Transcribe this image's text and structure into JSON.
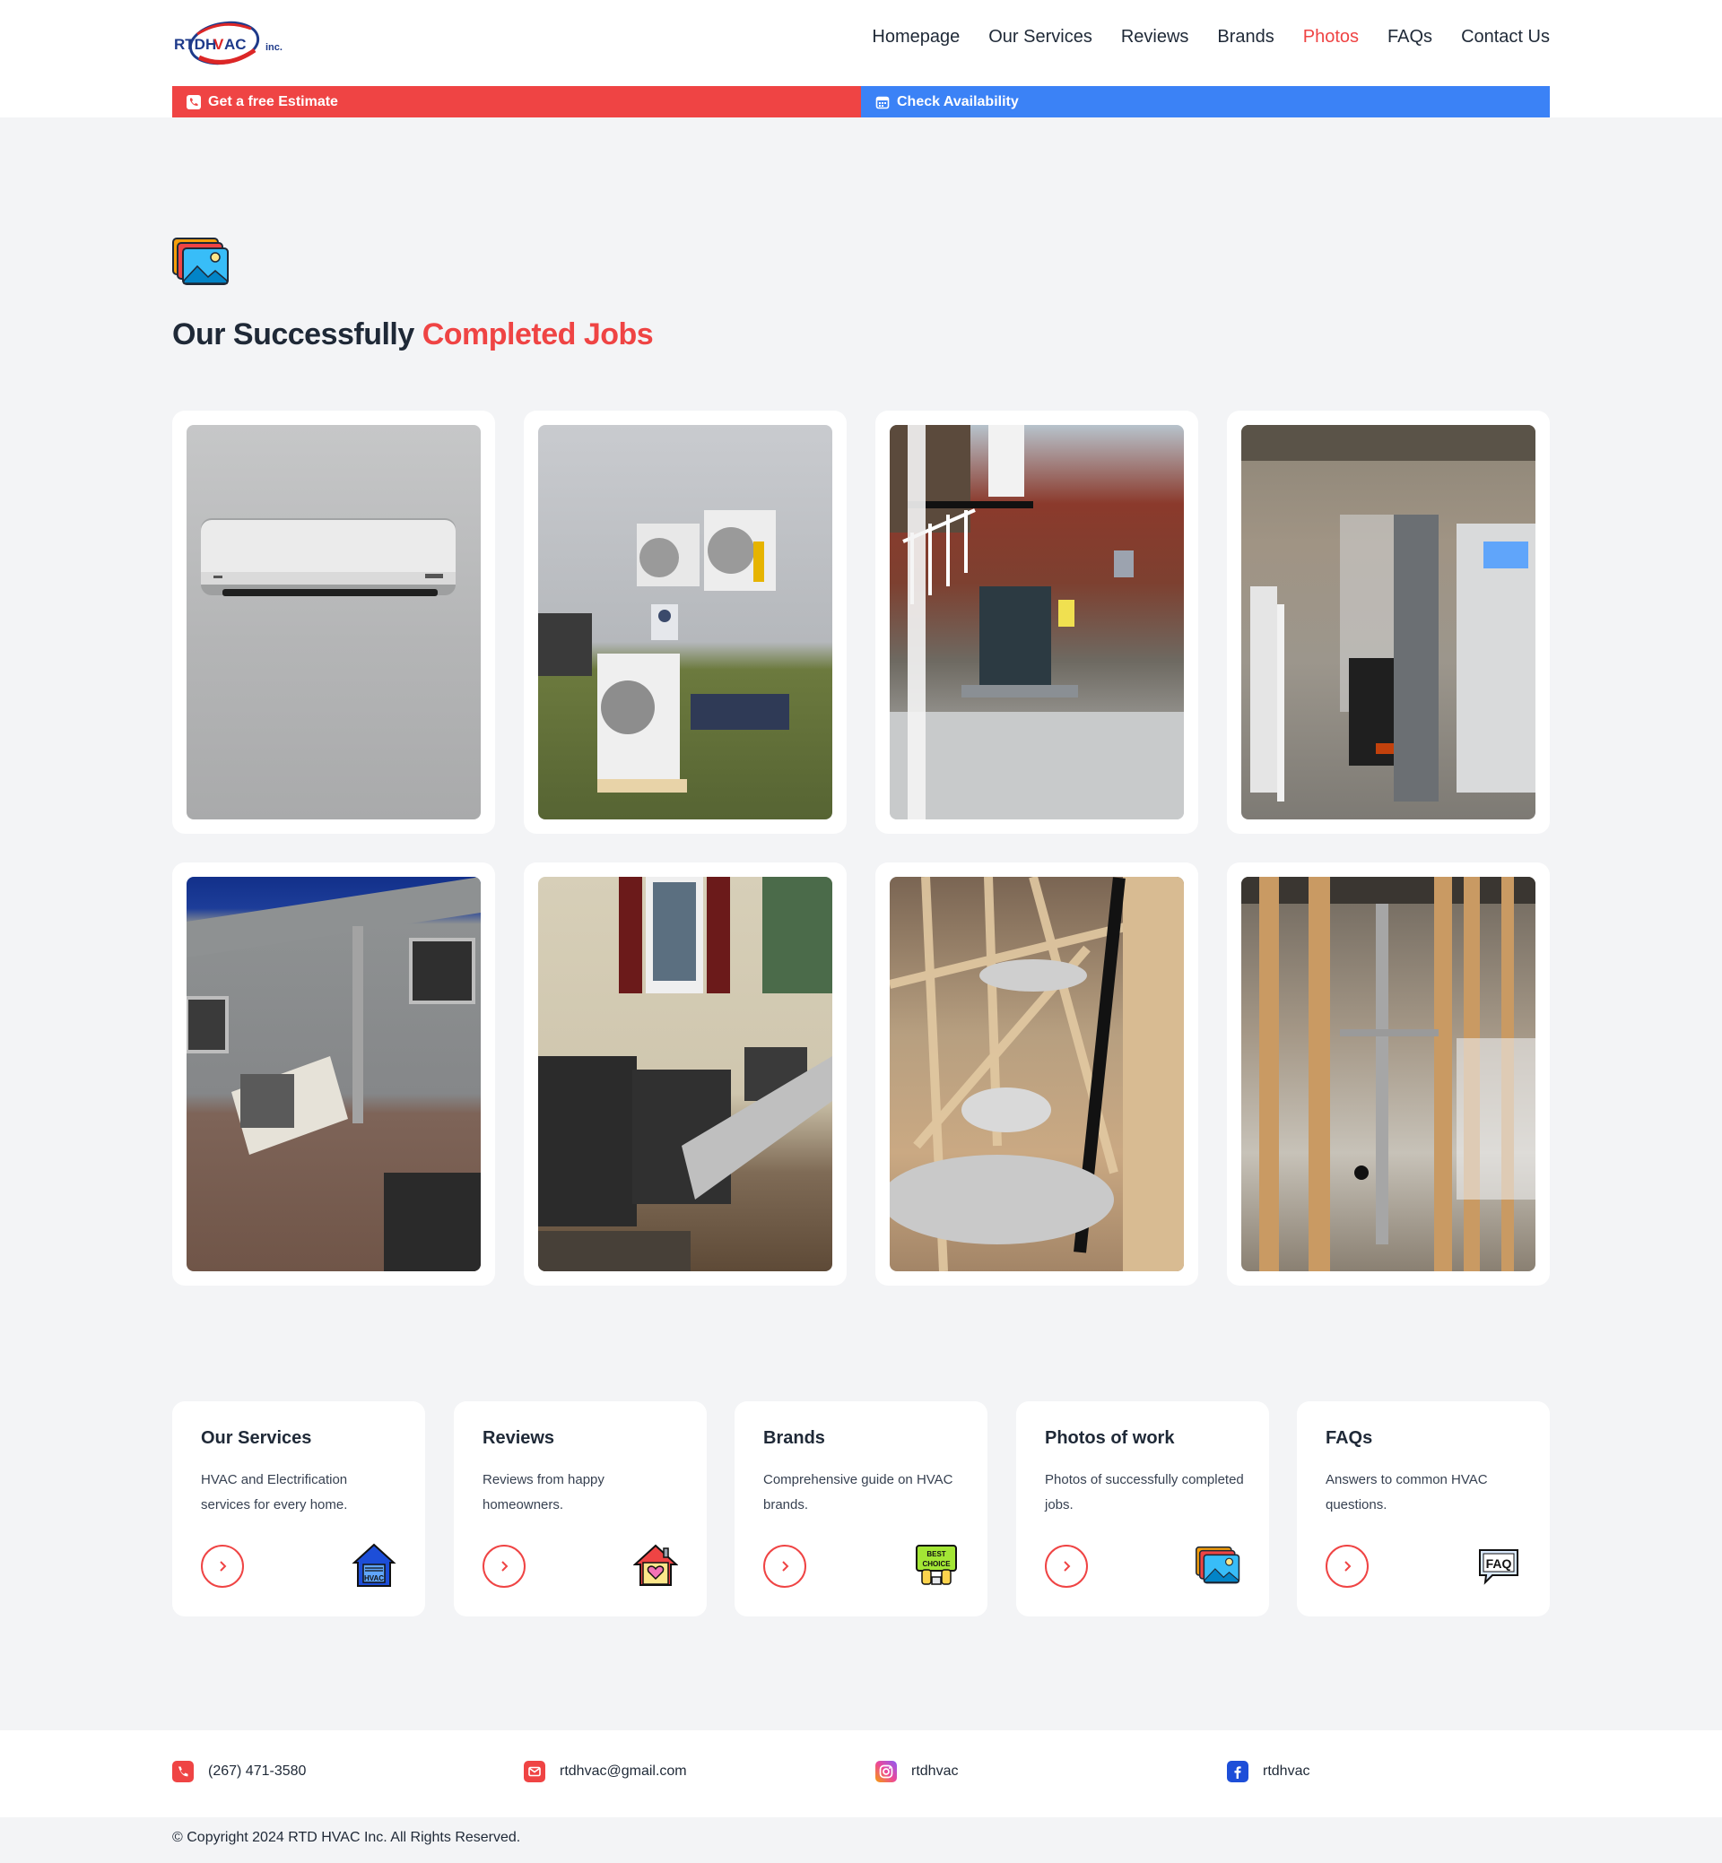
{
  "brand": {
    "logo_text": "RTDHVAC",
    "logo_suffix": "inc."
  },
  "nav": {
    "items": [
      {
        "label": "Homepage"
      },
      {
        "label": "Our Services"
      },
      {
        "label": "Reviews"
      },
      {
        "label": "Brands"
      },
      {
        "label": "Photos",
        "active": true
      },
      {
        "label": "FAQs"
      },
      {
        "label": "Contact Us"
      }
    ]
  },
  "cta": {
    "estimate_label": "Get a free Estimate",
    "availability_label": "Check Availability"
  },
  "hero": {
    "title_main": "Our Successfully ",
    "title_accent": "Completed Jobs"
  },
  "photos": [
    {
      "subject": "wall-mounted mini split indoor unit"
    },
    {
      "subject": "technician installing outdoor condensers"
    },
    {
      "subject": "AC condenser beside brick stairs"
    },
    {
      "subject": "furnace in basement"
    },
    {
      "subject": "wall-mounted heat pump outdoor unit"
    },
    {
      "subject": "condensers on pad beside house"
    },
    {
      "subject": "ductwork in attic trusses"
    },
    {
      "subject": "ducts in wood framing"
    }
  ],
  "services": [
    {
      "title": "Our Services",
      "desc": "HVAC and Electrification services for every home.",
      "icon": "hvac-house-icon"
    },
    {
      "title": "Reviews",
      "desc": "Reviews from happy homeowners.",
      "icon": "home-heart-icon"
    },
    {
      "title": "Brands",
      "desc": "Comprehensive guide on HVAC brands.",
      "icon": "best-choice-icon",
      "icon_text": "BEST CHOICE"
    },
    {
      "title": "Photos of work",
      "desc": "Photos of successfully completed jobs.",
      "icon": "photos-icon"
    },
    {
      "title": "FAQs",
      "desc": "Answers to common HVAC questions.",
      "icon": "faq-icon",
      "icon_text": "FAQ"
    }
  ],
  "footer": {
    "phone": "(267) 471-3580",
    "email": "rtdhvac@gmail.com",
    "instagram": "rtdhvac",
    "facebook": "rtdhvac",
    "copyright": "© Copyright 2024 RTD HVAC Inc. All Rights Reserved."
  },
  "colors": {
    "accent_red": "#ef4444",
    "accent_blue": "#3b82f6",
    "background": "#f3f4f6"
  }
}
